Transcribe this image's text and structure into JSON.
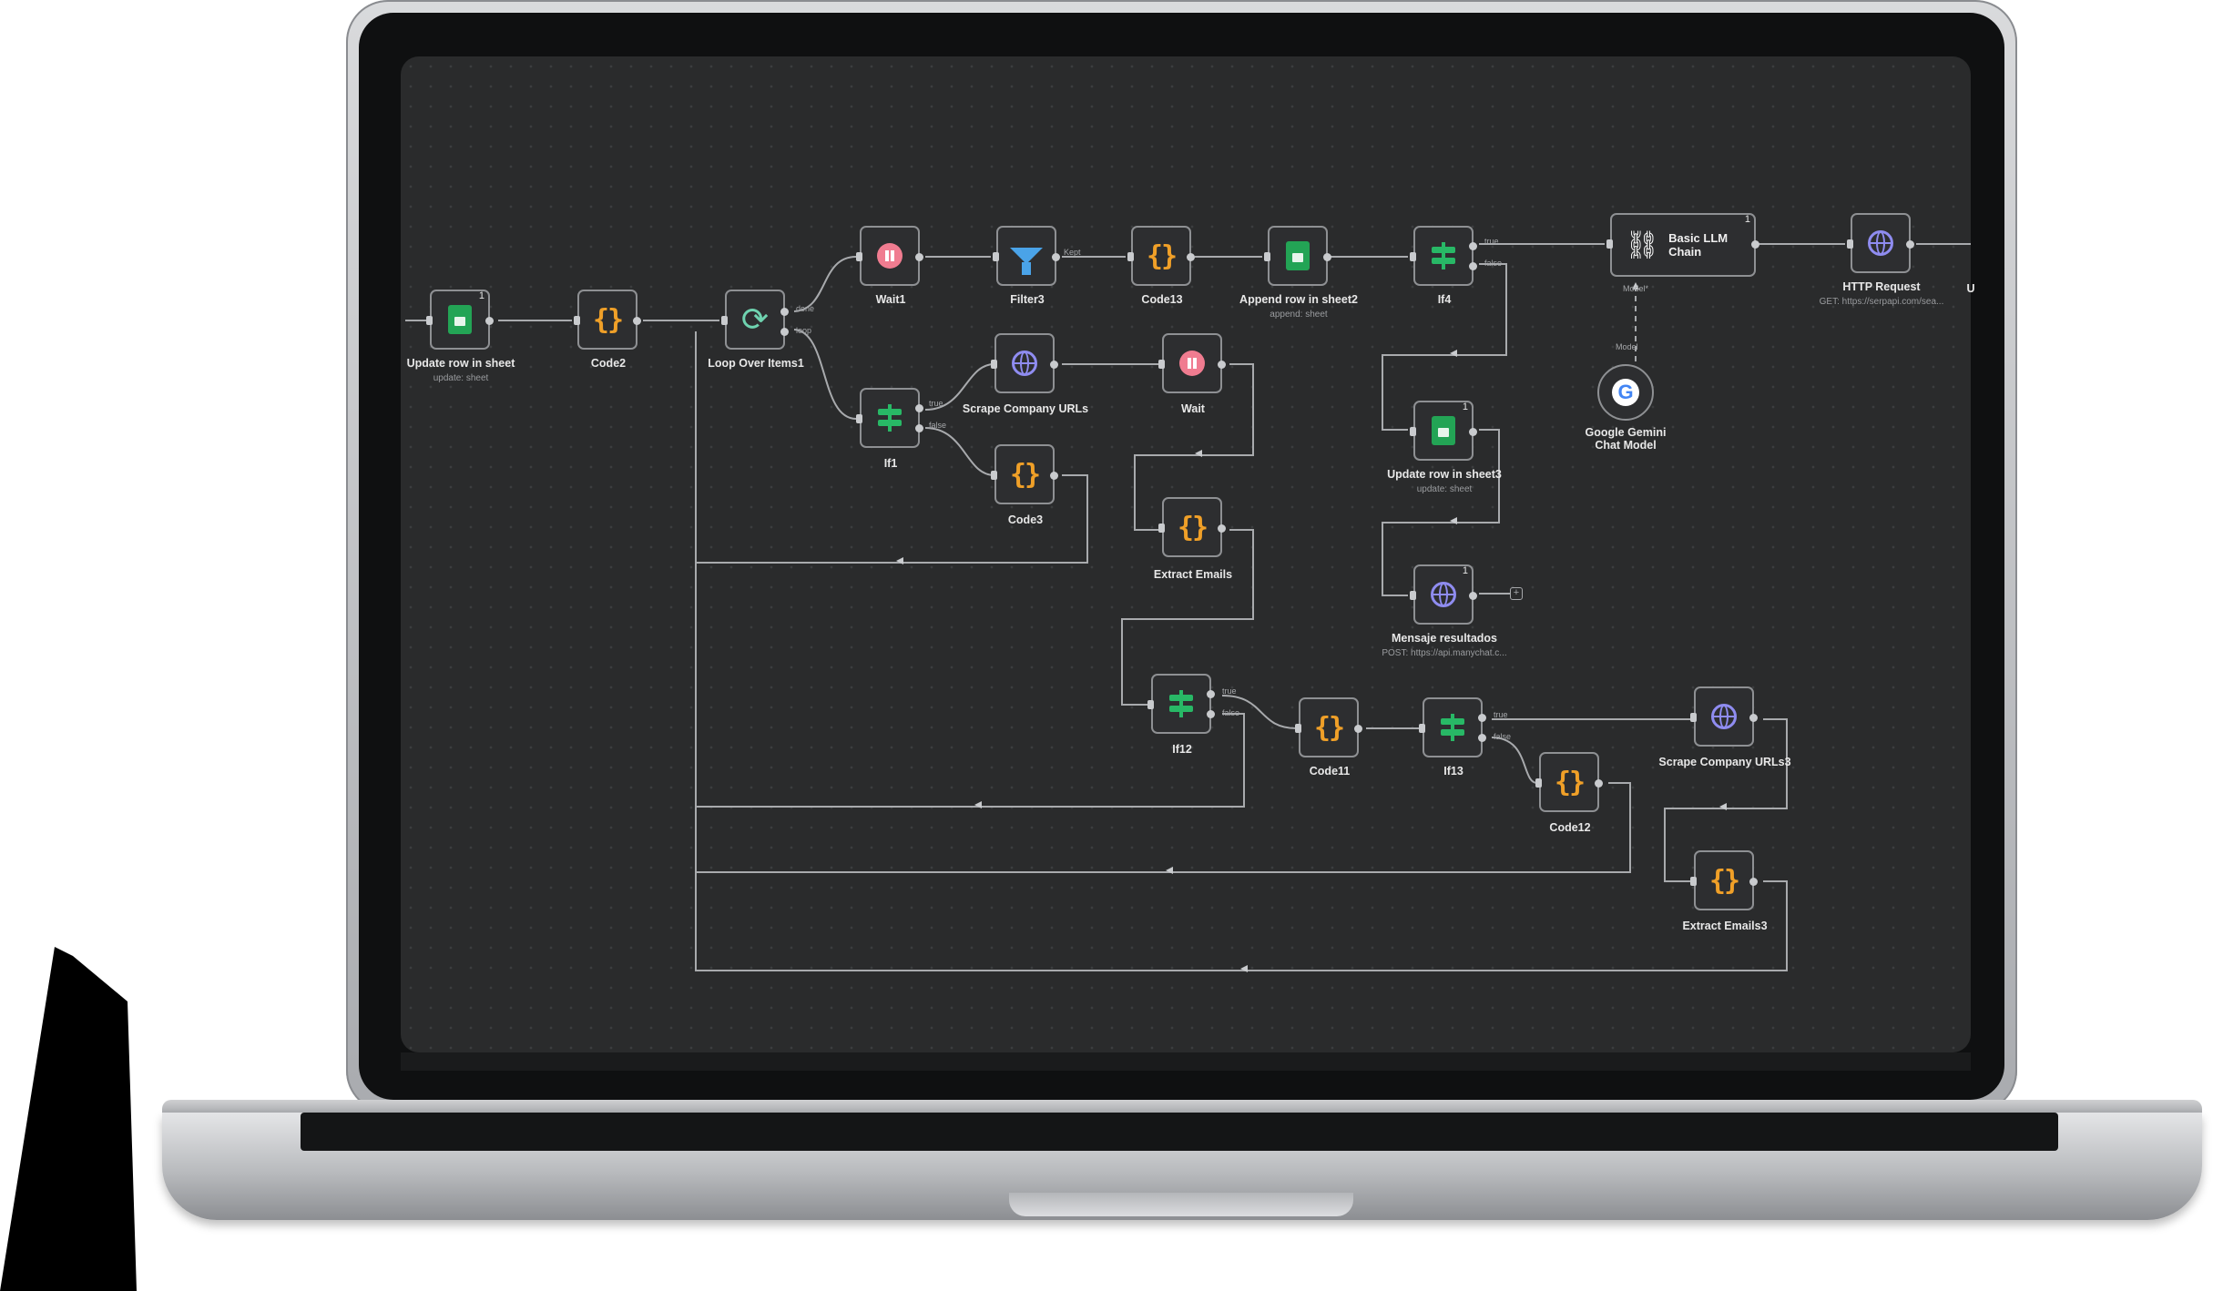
{
  "nodes": {
    "update_row": {
      "label": "Update row in sheet",
      "sub": "update: sheet",
      "badge": "1"
    },
    "code2": {
      "label": "Code2"
    },
    "loop": {
      "label": "Loop Over Items1",
      "out_done": "done",
      "out_loop": "loop"
    },
    "wait1": {
      "label": "Wait1"
    },
    "filter3": {
      "label": "Filter3",
      "out": "Kept"
    },
    "code13": {
      "label": "Code13"
    },
    "append_row": {
      "label": "Append row in sheet2",
      "sub": "append: sheet"
    },
    "if4": {
      "label": "If4",
      "out_true": "true",
      "out_false": "false"
    },
    "llm_chain": {
      "label": "Basic LLM Chain",
      "badge": "1",
      "model_tag": "Model*"
    },
    "http_request": {
      "label": "HTTP Request",
      "sub": "GET: https://serpapi.com/sea..."
    },
    "edge_cut": {
      "label": "U"
    },
    "gemini": {
      "label": "Google Gemini Chat Model",
      "tag": "Model"
    },
    "scrape_urls": {
      "label": "Scrape Company URLs"
    },
    "wait": {
      "label": "Wait"
    },
    "if1": {
      "label": "If1",
      "out_true": "true",
      "out_false": "false"
    },
    "code3": {
      "label": "Code3"
    },
    "update_row3": {
      "label": "Update row in sheet3",
      "sub": "update: sheet",
      "badge": "1"
    },
    "extract_emails": {
      "label": "Extract Emails"
    },
    "mensaje": {
      "label": "Mensaje resultados",
      "sub": "POST: https://api.manychat.c...",
      "badge": "1"
    },
    "if12": {
      "label": "If12",
      "out_true": "true",
      "out_false": "false"
    },
    "code11": {
      "label": "Code11"
    },
    "if13": {
      "label": "If13",
      "out_true": "true",
      "out_false": "false"
    },
    "scrape_urls3": {
      "label": "Scrape Company URLs3"
    },
    "code12": {
      "label": "Code12"
    },
    "extract_emails3": {
      "label": "Extract Emails3"
    }
  },
  "icons": {
    "sheets": "google-sheets-icon",
    "code": "code-braces-icon",
    "loop": "loop-icon",
    "wait": "pause-icon",
    "filter": "filter-icon",
    "if": "if-branch-icon",
    "http": "globe-icon",
    "chain": "link-icon",
    "gemini": "google-icon"
  },
  "colors": {
    "canvas": "#2a2b2c",
    "sheets": "#23a455",
    "code": "#f0a028",
    "wait": "#f07c90",
    "filter": "#4aa3e8",
    "if": "#28b866",
    "http": "#8f8cf0",
    "loop": "#6fd3b0"
  }
}
